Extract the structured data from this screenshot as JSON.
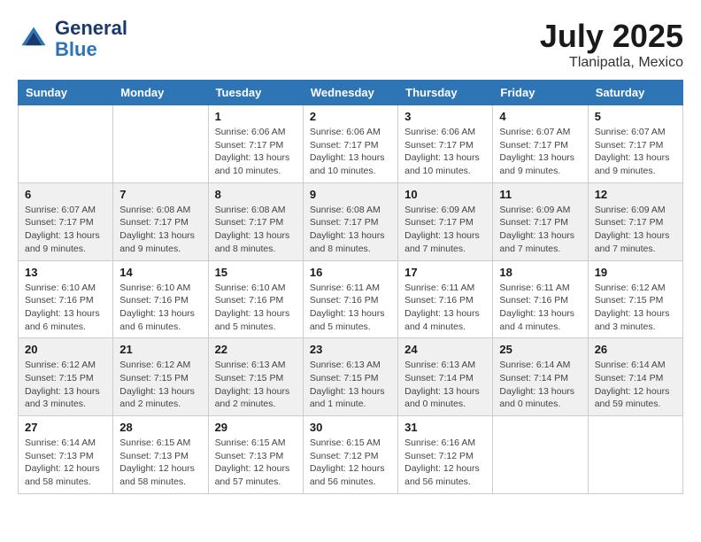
{
  "header": {
    "logo_line1": "General",
    "logo_line2": "Blue",
    "month": "July 2025",
    "location": "Tlanipatla, Mexico"
  },
  "weekdays": [
    "Sunday",
    "Monday",
    "Tuesday",
    "Wednesday",
    "Thursday",
    "Friday",
    "Saturday"
  ],
  "weeks": [
    [
      {
        "day": "",
        "sunrise": "",
        "sunset": "",
        "daylight": ""
      },
      {
        "day": "",
        "sunrise": "",
        "sunset": "",
        "daylight": ""
      },
      {
        "day": "1",
        "sunrise": "Sunrise: 6:06 AM",
        "sunset": "Sunset: 7:17 PM",
        "daylight": "Daylight: 13 hours and 10 minutes."
      },
      {
        "day": "2",
        "sunrise": "Sunrise: 6:06 AM",
        "sunset": "Sunset: 7:17 PM",
        "daylight": "Daylight: 13 hours and 10 minutes."
      },
      {
        "day": "3",
        "sunrise": "Sunrise: 6:06 AM",
        "sunset": "Sunset: 7:17 PM",
        "daylight": "Daylight: 13 hours and 10 minutes."
      },
      {
        "day": "4",
        "sunrise": "Sunrise: 6:07 AM",
        "sunset": "Sunset: 7:17 PM",
        "daylight": "Daylight: 13 hours and 9 minutes."
      },
      {
        "day": "5",
        "sunrise": "Sunrise: 6:07 AM",
        "sunset": "Sunset: 7:17 PM",
        "daylight": "Daylight: 13 hours and 9 minutes."
      }
    ],
    [
      {
        "day": "6",
        "sunrise": "Sunrise: 6:07 AM",
        "sunset": "Sunset: 7:17 PM",
        "daylight": "Daylight: 13 hours and 9 minutes."
      },
      {
        "day": "7",
        "sunrise": "Sunrise: 6:08 AM",
        "sunset": "Sunset: 7:17 PM",
        "daylight": "Daylight: 13 hours and 9 minutes."
      },
      {
        "day": "8",
        "sunrise": "Sunrise: 6:08 AM",
        "sunset": "Sunset: 7:17 PM",
        "daylight": "Daylight: 13 hours and 8 minutes."
      },
      {
        "day": "9",
        "sunrise": "Sunrise: 6:08 AM",
        "sunset": "Sunset: 7:17 PM",
        "daylight": "Daylight: 13 hours and 8 minutes."
      },
      {
        "day": "10",
        "sunrise": "Sunrise: 6:09 AM",
        "sunset": "Sunset: 7:17 PM",
        "daylight": "Daylight: 13 hours and 7 minutes."
      },
      {
        "day": "11",
        "sunrise": "Sunrise: 6:09 AM",
        "sunset": "Sunset: 7:17 PM",
        "daylight": "Daylight: 13 hours and 7 minutes."
      },
      {
        "day": "12",
        "sunrise": "Sunrise: 6:09 AM",
        "sunset": "Sunset: 7:17 PM",
        "daylight": "Daylight: 13 hours and 7 minutes."
      }
    ],
    [
      {
        "day": "13",
        "sunrise": "Sunrise: 6:10 AM",
        "sunset": "Sunset: 7:16 PM",
        "daylight": "Daylight: 13 hours and 6 minutes."
      },
      {
        "day": "14",
        "sunrise": "Sunrise: 6:10 AM",
        "sunset": "Sunset: 7:16 PM",
        "daylight": "Daylight: 13 hours and 6 minutes."
      },
      {
        "day": "15",
        "sunrise": "Sunrise: 6:10 AM",
        "sunset": "Sunset: 7:16 PM",
        "daylight": "Daylight: 13 hours and 5 minutes."
      },
      {
        "day": "16",
        "sunrise": "Sunrise: 6:11 AM",
        "sunset": "Sunset: 7:16 PM",
        "daylight": "Daylight: 13 hours and 5 minutes."
      },
      {
        "day": "17",
        "sunrise": "Sunrise: 6:11 AM",
        "sunset": "Sunset: 7:16 PM",
        "daylight": "Daylight: 13 hours and 4 minutes."
      },
      {
        "day": "18",
        "sunrise": "Sunrise: 6:11 AM",
        "sunset": "Sunset: 7:16 PM",
        "daylight": "Daylight: 13 hours and 4 minutes."
      },
      {
        "day": "19",
        "sunrise": "Sunrise: 6:12 AM",
        "sunset": "Sunset: 7:15 PM",
        "daylight": "Daylight: 13 hours and 3 minutes."
      }
    ],
    [
      {
        "day": "20",
        "sunrise": "Sunrise: 6:12 AM",
        "sunset": "Sunset: 7:15 PM",
        "daylight": "Daylight: 13 hours and 3 minutes."
      },
      {
        "day": "21",
        "sunrise": "Sunrise: 6:12 AM",
        "sunset": "Sunset: 7:15 PM",
        "daylight": "Daylight: 13 hours and 2 minutes."
      },
      {
        "day": "22",
        "sunrise": "Sunrise: 6:13 AM",
        "sunset": "Sunset: 7:15 PM",
        "daylight": "Daylight: 13 hours and 2 minutes."
      },
      {
        "day": "23",
        "sunrise": "Sunrise: 6:13 AM",
        "sunset": "Sunset: 7:15 PM",
        "daylight": "Daylight: 13 hours and 1 minute."
      },
      {
        "day": "24",
        "sunrise": "Sunrise: 6:13 AM",
        "sunset": "Sunset: 7:14 PM",
        "daylight": "Daylight: 13 hours and 0 minutes."
      },
      {
        "day": "25",
        "sunrise": "Sunrise: 6:14 AM",
        "sunset": "Sunset: 7:14 PM",
        "daylight": "Daylight: 13 hours and 0 minutes."
      },
      {
        "day": "26",
        "sunrise": "Sunrise: 6:14 AM",
        "sunset": "Sunset: 7:14 PM",
        "daylight": "Daylight: 12 hours and 59 minutes."
      }
    ],
    [
      {
        "day": "27",
        "sunrise": "Sunrise: 6:14 AM",
        "sunset": "Sunset: 7:13 PM",
        "daylight": "Daylight: 12 hours and 58 minutes."
      },
      {
        "day": "28",
        "sunrise": "Sunrise: 6:15 AM",
        "sunset": "Sunset: 7:13 PM",
        "daylight": "Daylight: 12 hours and 58 minutes."
      },
      {
        "day": "29",
        "sunrise": "Sunrise: 6:15 AM",
        "sunset": "Sunset: 7:13 PM",
        "daylight": "Daylight: 12 hours and 57 minutes."
      },
      {
        "day": "30",
        "sunrise": "Sunrise: 6:15 AM",
        "sunset": "Sunset: 7:12 PM",
        "daylight": "Daylight: 12 hours and 56 minutes."
      },
      {
        "day": "31",
        "sunrise": "Sunrise: 6:16 AM",
        "sunset": "Sunset: 7:12 PM",
        "daylight": "Daylight: 12 hours and 56 minutes."
      },
      {
        "day": "",
        "sunrise": "",
        "sunset": "",
        "daylight": ""
      },
      {
        "day": "",
        "sunrise": "",
        "sunset": "",
        "daylight": ""
      }
    ]
  ]
}
